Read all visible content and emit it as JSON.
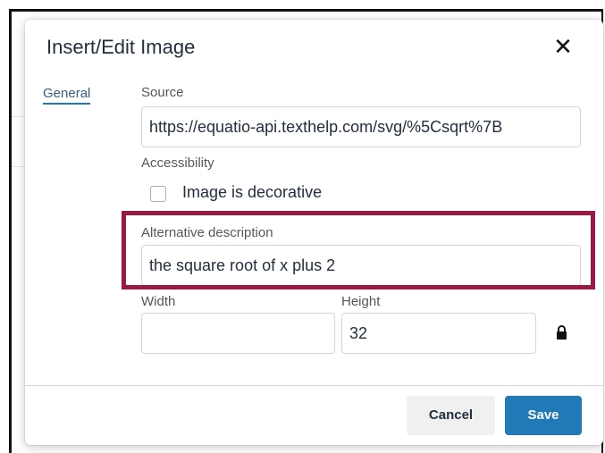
{
  "dialog": {
    "title": "Insert/Edit Image",
    "close_label": "✕"
  },
  "tabs": [
    {
      "label": "General",
      "active": true
    }
  ],
  "source": {
    "label": "Source",
    "value": "https://equatio-api.texthelp.com/svg/%5Csqrt%7B"
  },
  "accessibility": {
    "label": "Accessibility",
    "decorative_label": "Image is decorative",
    "decorative_checked": false
  },
  "alt": {
    "label": "Alternative description",
    "value": "the square root of x plus 2"
  },
  "dimensions": {
    "width_label": "Width",
    "width_value": "",
    "height_label": "Height",
    "height_value": "32",
    "lock_icon": "lock-icon"
  },
  "buttons": {
    "cancel": "Cancel",
    "save": "Save"
  },
  "colors": {
    "highlight": "#9b1a45",
    "primary": "#207ab7",
    "tab": "#335d8a"
  }
}
